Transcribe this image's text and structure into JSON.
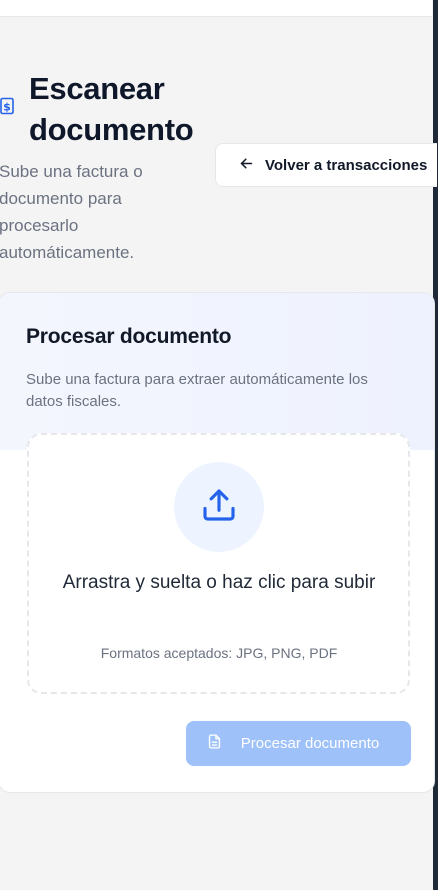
{
  "page": {
    "title": "Escanear documento",
    "subtitle": "Sube una factura o documento para procesarlo automáticamente.",
    "title_icon": "currency-document-icon"
  },
  "header": {
    "back_label": "Volver a transacciones",
    "back_icon": "arrow-left-icon"
  },
  "card": {
    "title": "Procesar documento",
    "description": "Sube una factura para extraer automáticamente los datos fiscales.",
    "dropzone": {
      "icon": "upload-icon",
      "text": "Arrastra y suelta o haz clic para subir",
      "formats": "Formatos aceptados: JPG, PNG, PDF"
    },
    "submit": {
      "label": "Procesar documento",
      "icon": "document-icon",
      "disabled": true
    }
  },
  "colors": {
    "accent": "#2563eb",
    "button_disabled": "#9ec1fa",
    "background": "#f4f4f5"
  }
}
